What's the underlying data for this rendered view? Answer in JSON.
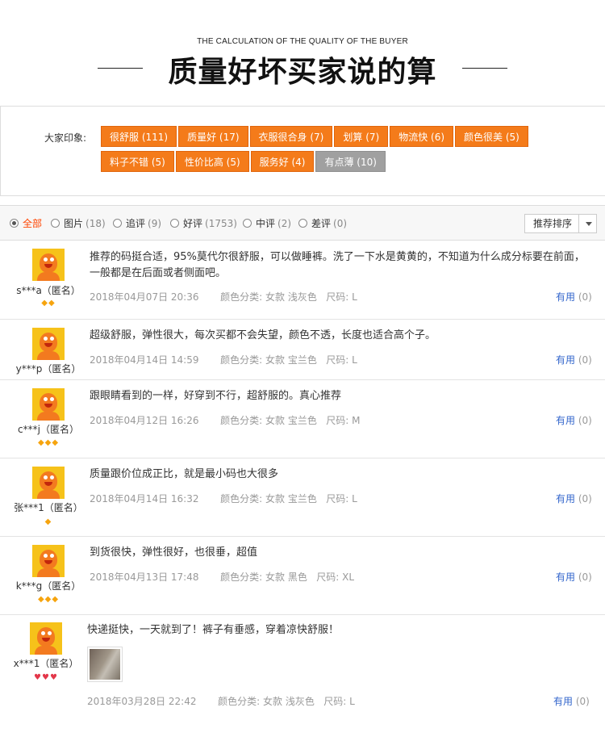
{
  "header": {
    "subtitle": "THE CALCULATION OF THE QUALITY OF THE BUYER",
    "title": "质量好坏买家说的算"
  },
  "impressions": {
    "label": "大家印象:",
    "tags": [
      {
        "text": "很舒服 (111)",
        "style": "orange"
      },
      {
        "text": "质量好 (17)",
        "style": "orange"
      },
      {
        "text": "衣服很合身 (7)",
        "style": "orange"
      },
      {
        "text": "划算 (7)",
        "style": "orange"
      },
      {
        "text": "物流快 (6)",
        "style": "orange"
      },
      {
        "text": "颜色很美 (5)",
        "style": "orange"
      },
      {
        "text": "料子不错 (5)",
        "style": "orange"
      },
      {
        "text": "性价比高 (5)",
        "style": "orange"
      },
      {
        "text": "服务好 (4)",
        "style": "orange"
      },
      {
        "text": "有点薄 (10)",
        "style": "gray"
      }
    ]
  },
  "filter": {
    "options": [
      {
        "label": "全部",
        "count": "",
        "selected": true
      },
      {
        "label": "图片",
        "count": "(18)"
      },
      {
        "label": "追评",
        "count": "(9)"
      },
      {
        "label": "好评",
        "count": "(1753)"
      },
      {
        "label": "中评",
        "count": "(2)"
      },
      {
        "label": "差评",
        "count": "(0)"
      }
    ],
    "sort_label": "推荐排序"
  },
  "reviews": [
    {
      "nick": "s***a（匿名）",
      "badges": "◆◆",
      "badge_color": "#f6a40e",
      "content": "推荐的码挺合适，95%莫代尔很舒服，可以做睡裤。洗了一下水是黄黄的，不知道为什么成分标要在前面，一般都是在后面或者侧面吧。",
      "meta": "2018年04月07日 20:36       颜色分类: 女款 浅灰色   尺码: L",
      "useful_label": "有用",
      "useful_count": "(0)"
    },
    {
      "nick": "y***p（匿名）",
      "badges": "",
      "badge_color": "#f6a40e",
      "content": "超级舒服，弹性很大，每次买都不会失望，颜色不透，长度也适合高个子。",
      "meta": "2018年04月14日 14:59       颜色分类: 女款 宝兰色   尺码: L",
      "useful_label": "有用",
      "useful_count": "(0)"
    },
    {
      "nick": "c***j（匿名）",
      "badges": "◆◆◆",
      "badge_color": "#f6a40e",
      "content": "跟眼睛看到的一样，好穿到不行，超舒服的。真心推荐",
      "meta": "2018年04月12日 16:26       颜色分类: 女款 宝兰色   尺码: M",
      "useful_label": "有用",
      "useful_count": "(0)"
    },
    {
      "nick": "张***1（匿名）",
      "badges": "◆",
      "badge_color": "#f6a40e",
      "content": "质量跟价位成正比，就是最小码也大很多",
      "meta": "2018年04月14日 16:32       颜色分类: 女款 宝兰色   尺码: L",
      "useful_label": "有用",
      "useful_count": "(0)"
    },
    {
      "nick": "k***g（匿名）",
      "badges": "◆◆◆",
      "badge_color": "#f6a40e",
      "content": "到货很快，弹性很好，也很垂，超值",
      "meta": "2018年04月13日 17:48       颜色分类: 女款 黑色   尺码: XL",
      "useful_label": "有用",
      "useful_count": "(0)"
    },
    {
      "nick": "x***1（匿名）",
      "badges": "♥♥♥",
      "badge_color": "#e3374a",
      "content": "快递挺快，一天就到了！裤子有垂感，穿着凉快舒服！",
      "meta": "2018年03月28日 22:42       颜色分类: 女款 浅灰色   尺码: L",
      "useful_label": "有用",
      "useful_count": "(0)",
      "has_photo": true
    }
  ]
}
